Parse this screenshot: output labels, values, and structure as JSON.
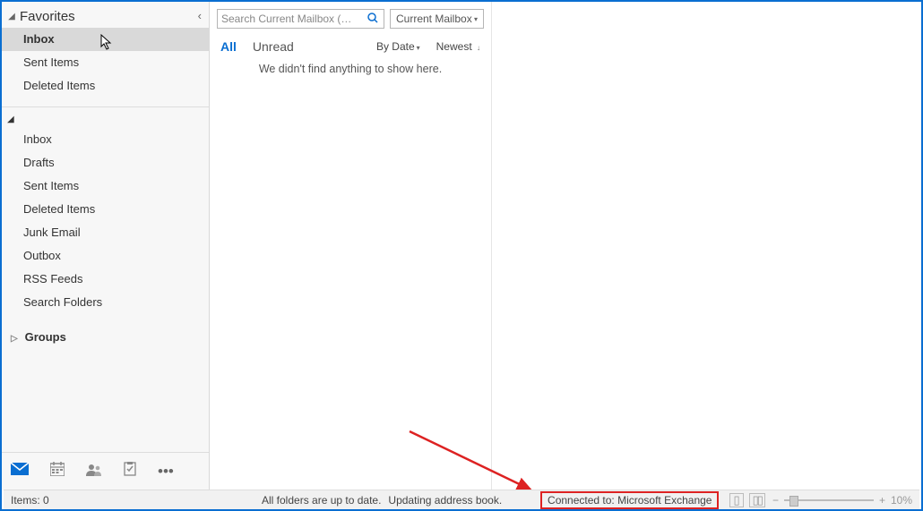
{
  "sidebar": {
    "favorites_label": "Favorites",
    "favorites": [
      {
        "label": "Inbox",
        "selected": true
      },
      {
        "label": "Sent Items"
      },
      {
        "label": "Deleted Items"
      }
    ],
    "folders": [
      {
        "label": "Inbox"
      },
      {
        "label": "Drafts"
      },
      {
        "label": "Sent Items"
      },
      {
        "label": "Deleted Items"
      },
      {
        "label": "Junk Email"
      },
      {
        "label": "Outbox"
      },
      {
        "label": "RSS Feeds"
      },
      {
        "label": "Search Folders"
      }
    ],
    "groups_label": "Groups"
  },
  "search": {
    "placeholder": "Search Current Mailbox (…",
    "scope": "Current Mailbox"
  },
  "filters": {
    "all": "All",
    "unread": "Unread",
    "sort_by": "By Date",
    "sort_order": "Newest"
  },
  "empty_message": "We didn't find anything to show here.",
  "nav": {
    "overflow": "•••"
  },
  "status": {
    "items": "Items: 0",
    "sync": "All folders are up to date.",
    "task": "Updating address book.",
    "connected": "Connected to: Microsoft Exchange",
    "zoom": "10%"
  }
}
